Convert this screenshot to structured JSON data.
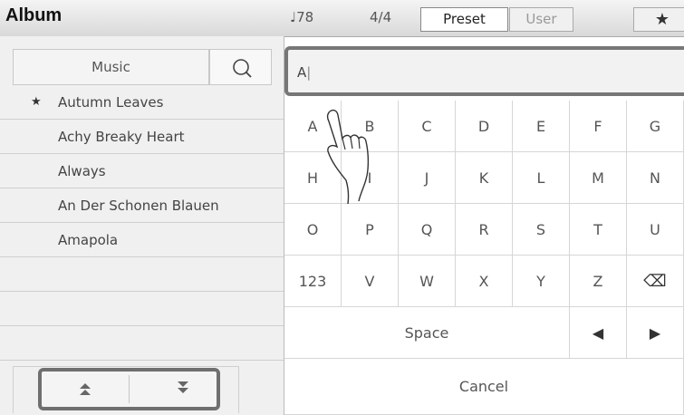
{
  "header": {
    "title": "Album",
    "tempo": "♩78",
    "meter": "4/4",
    "tabs": {
      "preset": "Preset",
      "user": "User",
      "favorite_icon": "star-icon"
    }
  },
  "left": {
    "category": "Music",
    "search_icon": "search-icon",
    "songs": [
      {
        "label": "Autumn Leaves",
        "favorite": true
      },
      {
        "label": "Achy Breaky Heart",
        "favorite": false
      },
      {
        "label": "Always",
        "favorite": false
      },
      {
        "label": "An Der Schonen Blauen",
        "favorite": false
      },
      {
        "label": "Amapola",
        "favorite": false
      },
      {
        "label": "",
        "favorite": false
      },
      {
        "label": "",
        "favorite": false
      },
      {
        "label": "",
        "favorite": false
      }
    ],
    "scroll_icons": [
      "page-up-icon",
      "page-down-icon"
    ]
  },
  "keyboard": {
    "input_value": "A",
    "rows": [
      [
        "A",
        "B",
        "C",
        "D",
        "E",
        "F",
        "G"
      ],
      [
        "H",
        "I",
        "J",
        "K",
        "L",
        "M",
        "N"
      ],
      [
        "O",
        "P",
        "Q",
        "R",
        "S",
        "T",
        "U"
      ],
      [
        "123",
        "V",
        "W",
        "X",
        "Y",
        "Z",
        "⌫"
      ]
    ],
    "space_label": "Space",
    "left_arrow": "◀",
    "right_arrow": "▶",
    "cancel_label": "Cancel"
  }
}
